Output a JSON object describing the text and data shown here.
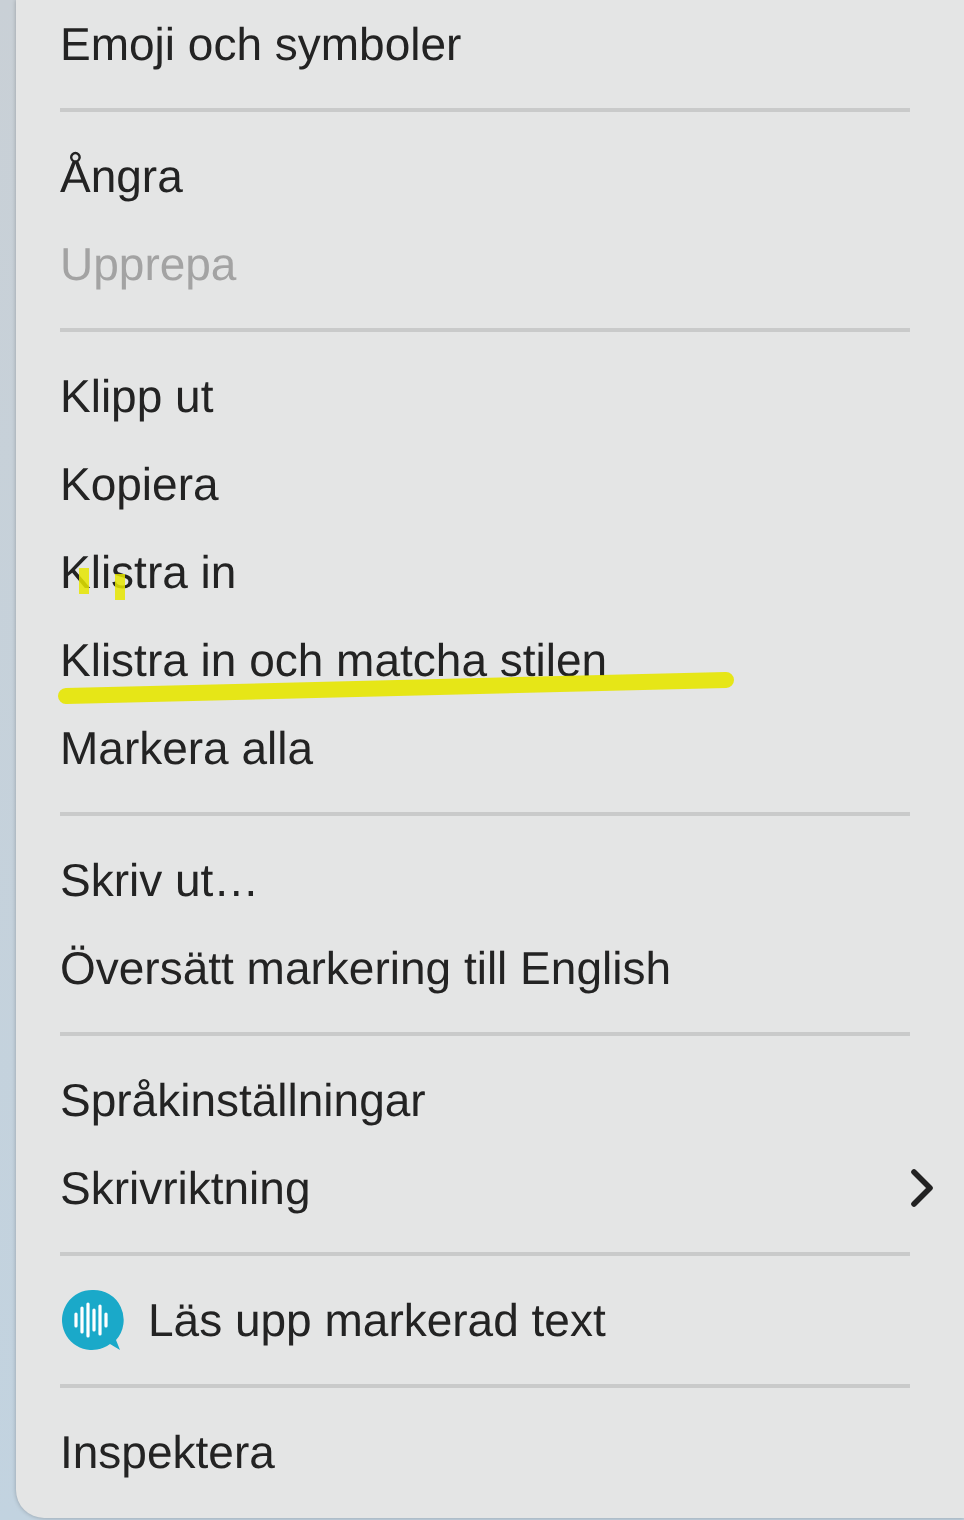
{
  "menu": {
    "groups": [
      [
        {
          "label": "Emoji och symboler",
          "disabled": false,
          "underlined": false,
          "ticked": false
        }
      ],
      [
        {
          "label": "Ångra",
          "disabled": false,
          "underlined": false,
          "ticked": false
        },
        {
          "label": "Upprepa",
          "disabled": true,
          "underlined": false,
          "ticked": false
        }
      ],
      [
        {
          "label": "Klipp ut",
          "disabled": false,
          "underlined": false,
          "ticked": false
        },
        {
          "label": "Kopiera",
          "disabled": false,
          "underlined": false,
          "ticked": false
        },
        {
          "label": "Klistra in",
          "disabled": false,
          "underlined": false,
          "ticked": true
        },
        {
          "label": "Klistra in och matcha stilen",
          "disabled": false,
          "underlined": true,
          "ticked": false
        },
        {
          "label": "Markera alla",
          "disabled": false,
          "underlined": false,
          "ticked": false
        }
      ],
      [
        {
          "label": "Skriv ut…",
          "disabled": false,
          "underlined": false,
          "ticked": false
        },
        {
          "label": "Översätt markering till English",
          "disabled": false,
          "underlined": false,
          "ticked": false
        }
      ],
      [
        {
          "label": "Språkinställningar",
          "disabled": false,
          "underlined": false,
          "ticked": false
        },
        {
          "label": "Skrivriktning",
          "disabled": false,
          "underlined": false,
          "ticked": false,
          "submenu": true
        }
      ],
      [
        {
          "label": "Läs upp markerad text",
          "disabled": false,
          "underlined": false,
          "ticked": false,
          "kind": "speech"
        }
      ],
      [
        {
          "label": "Inspektera",
          "disabled": false,
          "underlined": false,
          "ticked": false
        }
      ]
    ]
  }
}
